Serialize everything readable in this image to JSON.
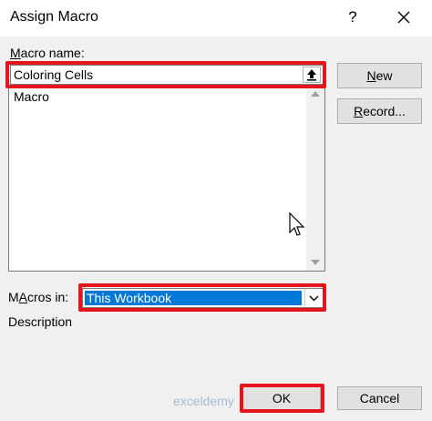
{
  "window": {
    "title": "Assign Macro",
    "help_glyph": "?",
    "close_glyph": "✕"
  },
  "form": {
    "macro_name_label_ul": "M",
    "macro_name_label_rest": "acro name:",
    "macro_name_value": "Coloring Cells",
    "macro_list": [
      "Macro"
    ],
    "macros_in_label_ul": "A",
    "macros_in_label_rest": "cros in:",
    "macros_in_label_prefix": "M",
    "macros_in_value": "This Workbook",
    "description_label": "Description"
  },
  "buttons": {
    "new_ul": "N",
    "new_rest": "ew",
    "record_ul": "R",
    "record_rest": "ecord...",
    "ok": "OK",
    "cancel": "Cancel"
  },
  "watermark": {
    "text": "exceldemy"
  },
  "colors": {
    "highlight": "#e8141c",
    "selection": "#0078d7"
  },
  "icons": {
    "upload": "upload-arrow-icon",
    "dropdown": "chevron-down-icon",
    "close": "close-icon",
    "help": "help-icon"
  }
}
